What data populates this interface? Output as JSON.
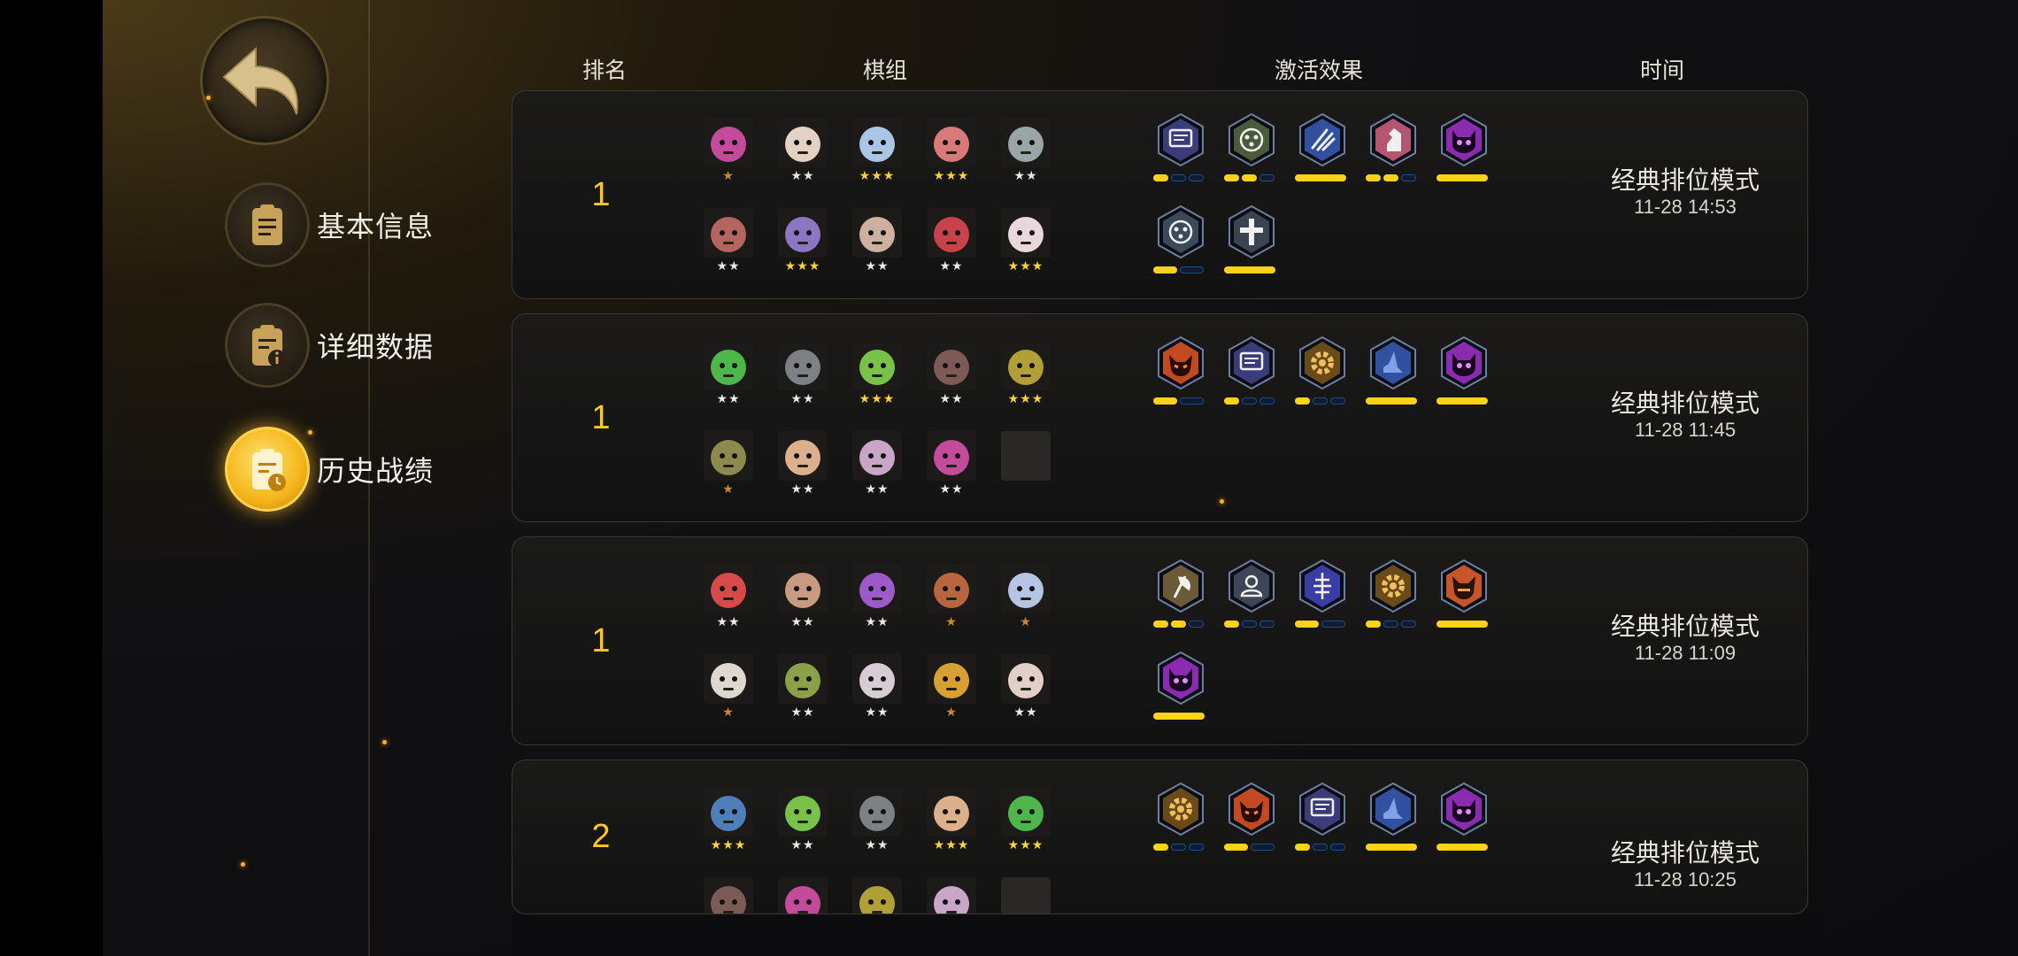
{
  "colors": {
    "gold": "#ffc820",
    "active_nav": "#f4b51a",
    "bar_on": "#ffd214",
    "bar_off": "#1a4f8c"
  },
  "back_button": {
    "icon": "back-arrow-icon"
  },
  "nav": [
    {
      "label": "基本信息",
      "icon": "clipboard-icon",
      "active": false
    },
    {
      "label": "详细数据",
      "icon": "clipboard-info-icon",
      "active": false
    },
    {
      "label": "历史战绩",
      "icon": "clipboard-clock-icon",
      "active": true
    }
  ],
  "headers": {
    "rank": "排名",
    "lineup": "棋组",
    "effects": "激活效果",
    "time": "时间"
  },
  "matches": [
    {
      "rank": "1",
      "mode": "经典排位模式",
      "time": "11-28 14:53",
      "heroes": [
        {
          "stars": "★",
          "tier": 1,
          "color": "#c34b9c"
        },
        {
          "stars": "★★",
          "tier": 2,
          "color": "#e3d2c4"
        },
        {
          "stars": "★★★",
          "tier": 3,
          "color": "#aac6e4"
        },
        {
          "stars": "★★★",
          "tier": 3,
          "color": "#d97a7a"
        },
        {
          "stars": "★★",
          "tier": 2,
          "color": "#9aa6a6"
        },
        {
          "stars": "★★",
          "tier": 2,
          "color": "#b4665e"
        },
        {
          "stars": "★★★",
          "tier": 3,
          "color": "#8c76c2"
        },
        {
          "stars": "★★",
          "tier": 2,
          "color": "#ceb0a0"
        },
        {
          "stars": "★★",
          "tier": 2,
          "color": "#c8424a"
        },
        {
          "stars": "★★★",
          "tier": 3,
          "color": "#e8d7dc"
        }
      ],
      "synergies": [
        {
          "icon": "book-icon",
          "fill": "#3a3d7a",
          "segs": [
            1,
            0,
            0
          ]
        },
        {
          "icon": "dots-icon",
          "fill": "#4a5a3c",
          "segs": [
            1,
            1,
            0
          ]
        },
        {
          "icon": "claw-icon",
          "fill": "#3150a0",
          "segs": [
            1
          ]
        },
        {
          "icon": "knight-icon",
          "fill": "#b45672",
          "segs": [
            1,
            1,
            0
          ]
        },
        {
          "icon": "demon-icon",
          "fill": "#8a2bb0",
          "segs": [
            1
          ]
        },
        {
          "icon": "dots-icon",
          "fill": "#3a4a5a",
          "segs": [
            1,
            0
          ]
        },
        {
          "icon": "cross-icon",
          "fill": "#3a4450",
          "segs": [
            1
          ]
        }
      ]
    },
    {
      "rank": "1",
      "mode": "经典排位模式",
      "time": "11-28 11:45",
      "heroes": [
        {
          "stars": "★★",
          "tier": 2,
          "color": "#4fb64b"
        },
        {
          "stars": "★★",
          "tier": 2,
          "color": "#7d8085"
        },
        {
          "stars": "★★★",
          "tier": 3,
          "color": "#79c24a"
        },
        {
          "stars": "★★",
          "tier": 2,
          "color": "#7c5a56"
        },
        {
          "stars": "★★★",
          "tier": 3,
          "color": "#b1a038"
        },
        {
          "stars": "★",
          "tier": 1,
          "color": "#8c8a4e"
        },
        {
          "stars": "★★",
          "tier": 2,
          "color": "#dcb08c"
        },
        {
          "stars": "★★",
          "tier": 2,
          "color": "#c9a6c8"
        },
        {
          "stars": "★★",
          "tier": 2,
          "color": "#c34b9c"
        },
        {
          "stars": "",
          "tier": 0,
          "color": "#2a2826"
        }
      ],
      "synergies": [
        {
          "icon": "demon-face-icon",
          "fill": "#c24a22",
          "segs": [
            1,
            0
          ]
        },
        {
          "icon": "book-icon",
          "fill": "#3a3d7a",
          "segs": [
            1,
            0,
            0
          ]
        },
        {
          "icon": "gear-icon",
          "fill": "#6b4a1a",
          "segs": [
            1,
            0,
            0
          ]
        },
        {
          "icon": "wizard-hat-icon",
          "fill": "#3150a0",
          "segs": [
            1
          ]
        },
        {
          "icon": "demon-icon",
          "fill": "#8a2bb0",
          "segs": [
            1
          ]
        }
      ]
    },
    {
      "rank": "1",
      "mode": "经典排位模式",
      "time": "11-28 11:09",
      "heroes": [
        {
          "stars": "★★",
          "tier": 2,
          "color": "#d64a4a"
        },
        {
          "stars": "★★",
          "tier": 2,
          "color": "#c89a82"
        },
        {
          "stars": "★★",
          "tier": 2,
          "color": "#9d5ac8"
        },
        {
          "stars": "★",
          "tier": 1,
          "color": "#b7663e"
        },
        {
          "stars": "★",
          "tier": 1,
          "color": "#b6c4e4"
        },
        {
          "stars": "★",
          "tier": 1,
          "color": "#ded7cf"
        },
        {
          "stars": "★★",
          "tier": 2,
          "color": "#8ca04a"
        },
        {
          "stars": "★★",
          "tier": 2,
          "color": "#d8ccd4"
        },
        {
          "stars": "★",
          "tier": 1,
          "color": "#d8a032"
        },
        {
          "stars": "★★",
          "tier": 2,
          "color": "#e2cfc9"
        }
      ],
      "synergies": [
        {
          "icon": "axe-icon",
          "fill": "#6b5a38",
          "segs": [
            1,
            1,
            0
          ]
        },
        {
          "icon": "person-icon",
          "fill": "#3c4654",
          "segs": [
            1,
            0,
            0
          ]
        },
        {
          "icon": "fish-icon",
          "fill": "#3a3da6",
          "segs": [
            1,
            0
          ]
        },
        {
          "icon": "gear-icon",
          "fill": "#6b4a1a",
          "segs": [
            1,
            0,
            0
          ]
        },
        {
          "icon": "horned-icon",
          "fill": "#c6552a",
          "segs": [
            1
          ]
        },
        {
          "icon": "demon-icon",
          "fill": "#8a2bb0",
          "segs": [
            1
          ]
        }
      ]
    },
    {
      "rank": "2",
      "mode": "经典排位模式",
      "time": "11-28 10:25",
      "heroes": [
        {
          "stars": "★★★",
          "tier": 3,
          "color": "#4f7fbb"
        },
        {
          "stars": "★★",
          "tier": 2,
          "color": "#79c24a"
        },
        {
          "stars": "★★",
          "tier": 2,
          "color": "#7d8085"
        },
        {
          "stars": "★★★",
          "tier": 3,
          "color": "#dcb08c"
        },
        {
          "stars": "★★★",
          "tier": 3,
          "color": "#4fb64b"
        },
        {
          "stars": "",
          "tier": 0,
          "color": "#7c5a56"
        },
        {
          "stars": "",
          "tier": 0,
          "color": "#c34b9c"
        },
        {
          "stars": "",
          "tier": 0,
          "color": "#b1a038"
        },
        {
          "stars": "",
          "tier": 0,
          "color": "#c9a6c8"
        },
        {
          "stars": "",
          "tier": 0,
          "color": "#2a2826"
        }
      ],
      "synergies": [
        {
          "icon": "gear-icon",
          "fill": "#6b4a1a",
          "segs": [
            1,
            0,
            0
          ]
        },
        {
          "icon": "demon-face-icon",
          "fill": "#c24a22",
          "segs": [
            1,
            0
          ]
        },
        {
          "icon": "book-icon",
          "fill": "#3a3d7a",
          "segs": [
            1,
            0,
            0
          ]
        },
        {
          "icon": "wizard-hat-icon",
          "fill": "#3150a0",
          "segs": [
            1
          ]
        },
        {
          "icon": "demon-icon",
          "fill": "#8a2bb0",
          "segs": [
            1
          ]
        }
      ]
    }
  ]
}
